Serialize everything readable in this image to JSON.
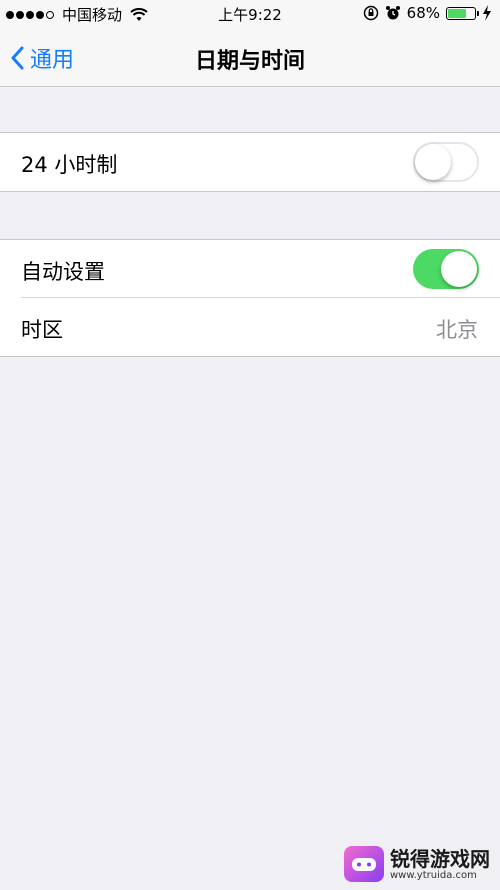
{
  "status_bar": {
    "carrier": "中国移动",
    "time": "上午9:22",
    "battery_percent": "68%",
    "battery_level": 0.68,
    "icons": [
      "signal-dots",
      "wifi-icon",
      "rotation-lock-icon",
      "alarm-icon",
      "battery-icon",
      "charging-icon"
    ]
  },
  "nav": {
    "back_label": "通用",
    "title": "日期与时间"
  },
  "settings": {
    "hour24": {
      "label": "24 小时制",
      "on": false
    },
    "auto_set": {
      "label": "自动设置",
      "on": true
    },
    "timezone": {
      "label": "时区",
      "value": "北京"
    }
  },
  "watermark": {
    "name": "锐得游戏网",
    "url": "www.ytruida.com"
  },
  "colors": {
    "accent": "#157efb",
    "switch_on": "#4cd964",
    "background": "#efeff4"
  }
}
